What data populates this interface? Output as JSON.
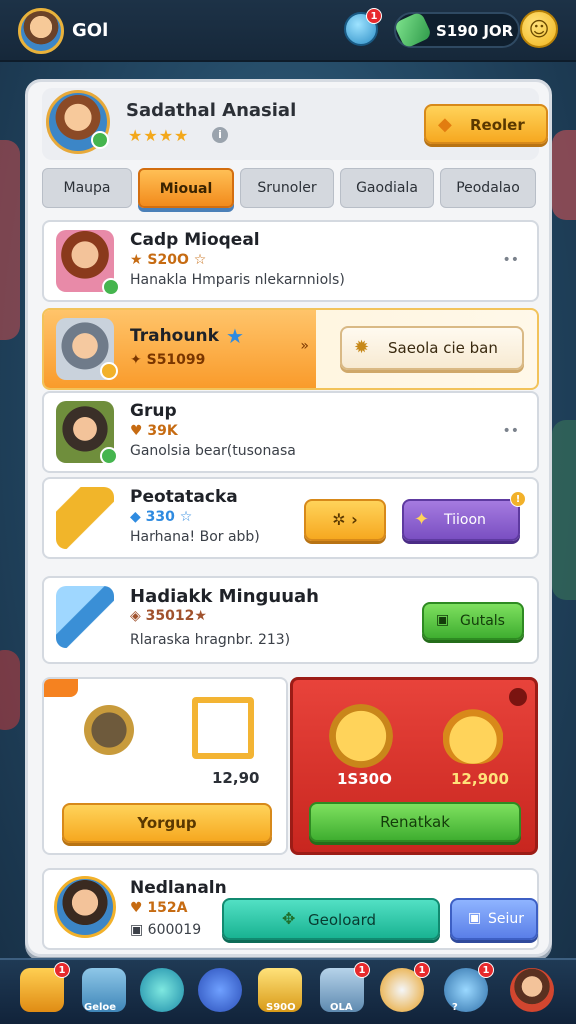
{
  "topbar": {
    "player_name": "GOl",
    "bell_badge": "1",
    "currency_value": "S190 JOR"
  },
  "header": {
    "title": "Sadathal Anasial",
    "stars": "★★★★",
    "action_label": "Reoler"
  },
  "tabs": [
    "Maupa",
    "Mioual",
    "Srunoler",
    "Gaodiala",
    "Peodalao"
  ],
  "rows": [
    {
      "title": "Cadp Mioqeal",
      "sub": "★ S20O ☆",
      "desc": "Hanakla Hmparis nlekarnniols)",
      "more": "••"
    },
    {
      "title": "Trahounk",
      "sub": "✦ S51099",
      "action": "Saeola cie ban",
      "more": "»"
    },
    {
      "title": "Grup",
      "sub": "♥ 39K",
      "desc": "Ganolsia bear(tusonasa",
      "more": "••"
    },
    {
      "title": "Peotatacka",
      "sub": "◆ 330 ☆",
      "desc": "Harhana! Bor abb)",
      "btn1": "✲ ›",
      "btn2": "Tiioon",
      "btn2_badge": "!"
    },
    {
      "title": "Hadiakk Minguuah",
      "sub": "◈ 35012★",
      "desc": "Rlaraska hragnbr. 213)",
      "action": "Gutals"
    }
  ],
  "shop": {
    "left_price": "12,90",
    "left_button": "Yorgup",
    "red_price1": "1S30O",
    "red_price2": "12,900",
    "red_button": "Renatkak"
  },
  "footer": {
    "name": "Nedlanaln",
    "sub": "♥ 152A",
    "sub2": "▣ 600019",
    "main_button": "Geoloard",
    "side_button": "Seiur"
  },
  "nav": {
    "items": [
      {
        "icon": "chest-icon",
        "badge": "1"
      },
      {
        "icon": "castle-icon",
        "label": "Geloe",
        "badge": ""
      },
      {
        "icon": "shield-icon"
      },
      {
        "icon": "compass-icon"
      },
      {
        "icon": "crown-icon",
        "label": "S90O"
      },
      {
        "icon": "house-icon",
        "label": "OLA",
        "badge": "1"
      },
      {
        "icon": "robot-icon",
        "badge": "1"
      },
      {
        "icon": "gear-icon",
        "label": "?",
        "badge": "1"
      },
      {
        "icon": "profile-icon"
      }
    ]
  },
  "colors": {
    "accent": "#f6a820",
    "danger": "#c8261f",
    "success": "#3fae30"
  }
}
